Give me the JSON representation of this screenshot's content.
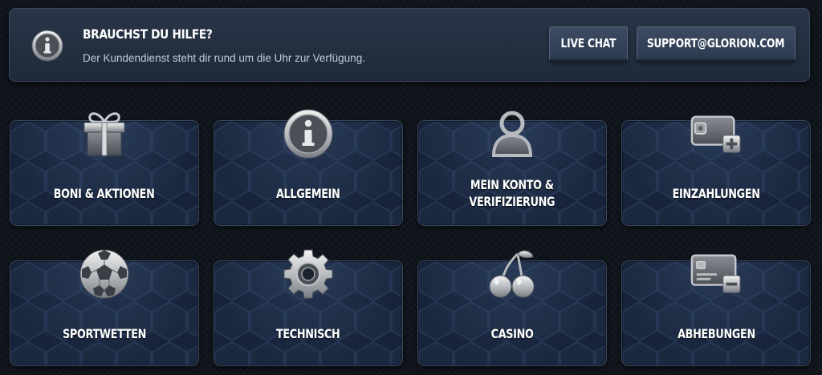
{
  "help": {
    "title": "BRAUCHST DU HILFE?",
    "subtitle": "Der Kundendienst steht dir rund um die Uhr zur Verfügung.",
    "live_chat_label": "LIVE CHAT",
    "email_label": "SUPPORT@GLORION.COM",
    "icon": "info-icon"
  },
  "categories": [
    {
      "label": "BONI & AKTIONEN",
      "icon": "gift-icon"
    },
    {
      "label": "ALLGEMEIN",
      "icon": "info-icon"
    },
    {
      "label": "MEIN KONTO &\nVERIFIZIERUNG",
      "icon": "user-icon"
    },
    {
      "label": "EINZAHLUNGEN",
      "icon": "wallet-plus-icon"
    },
    {
      "label": "SPORTWETTEN",
      "icon": "soccer-ball-icon"
    },
    {
      "label": "TECHNISCH",
      "icon": "gear-icon"
    },
    {
      "label": "CASINO",
      "icon": "cherries-icon"
    },
    {
      "label": "ABHEBUNGEN",
      "icon": "card-minus-icon"
    }
  ],
  "colors": {
    "background": "#0e131a",
    "banner": "#243145",
    "card": "#17233a",
    "text": "#ffffff",
    "subtext": "#c3cad6"
  }
}
